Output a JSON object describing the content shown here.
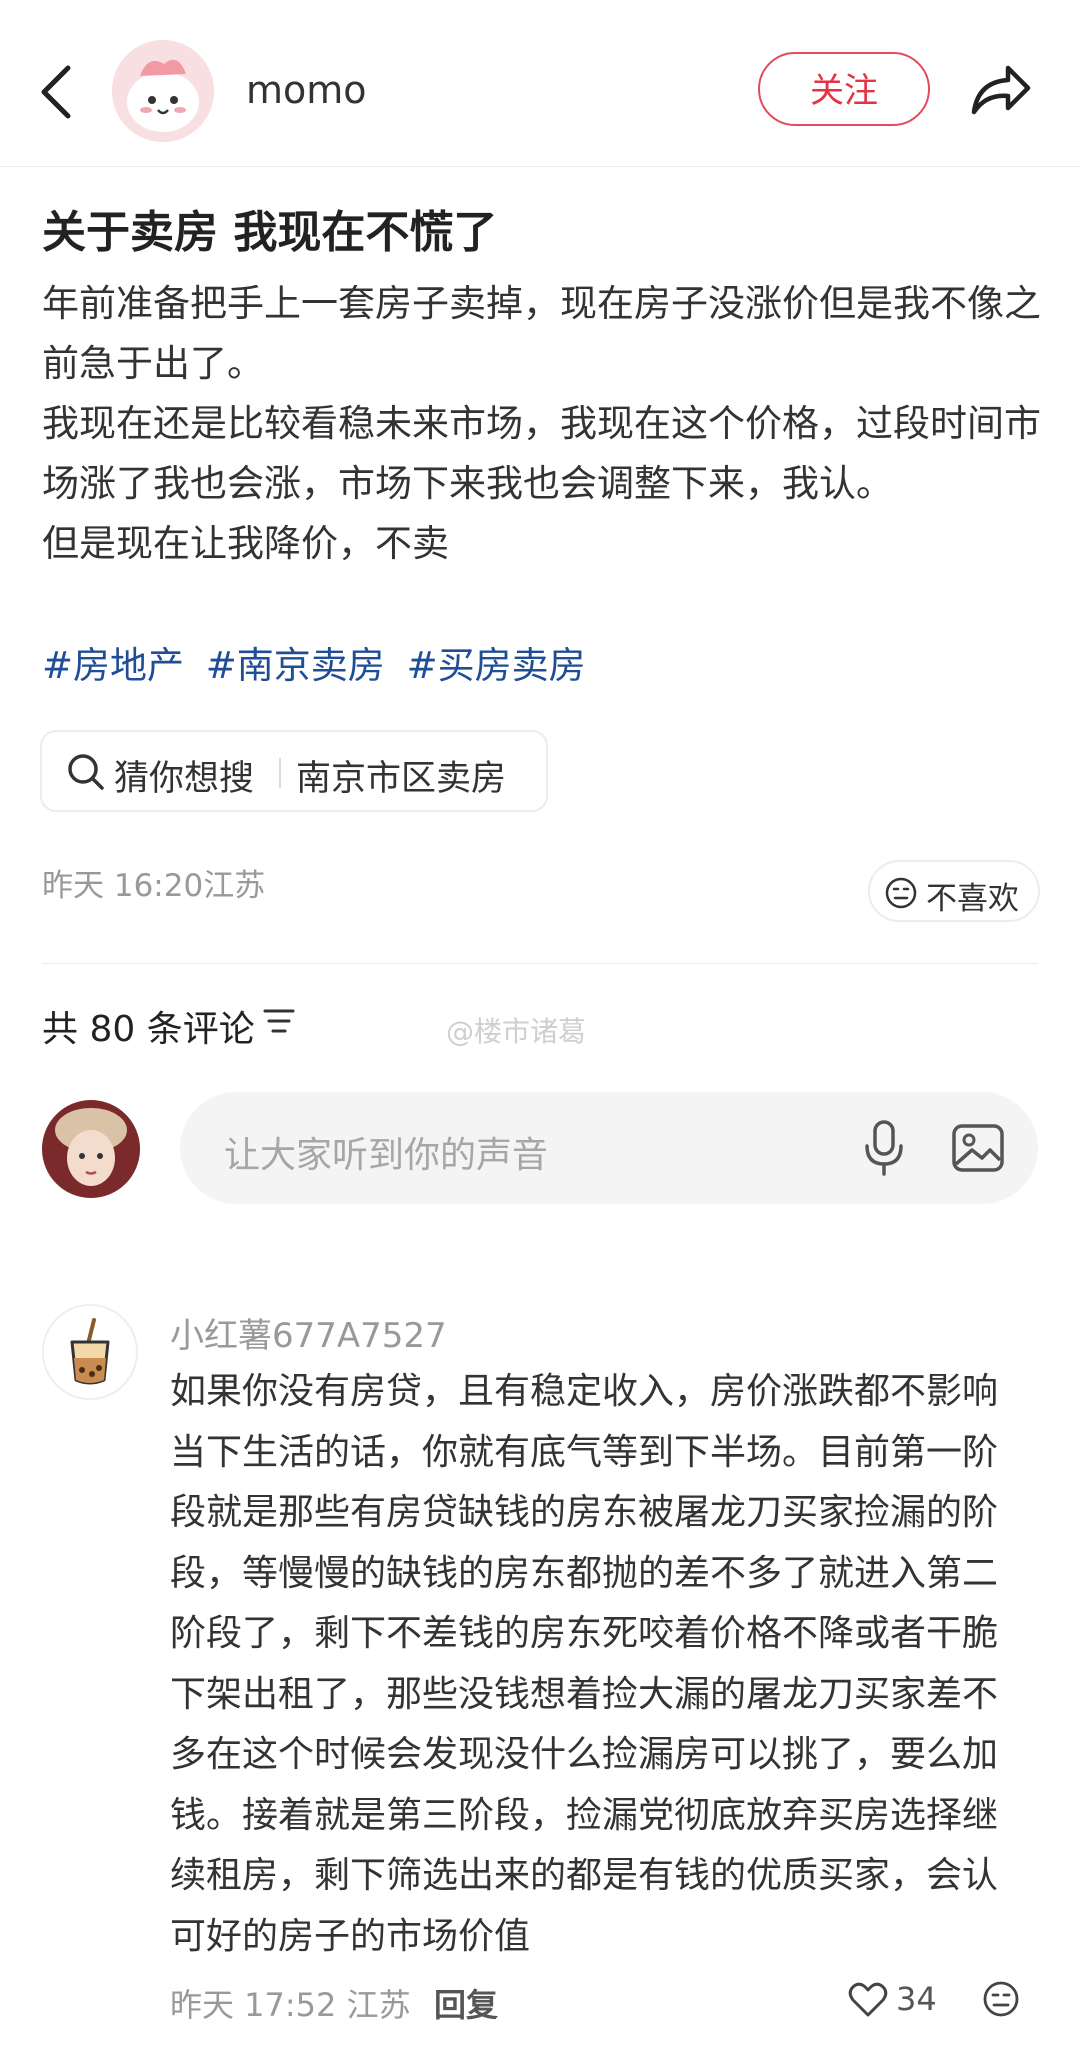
{
  "header": {
    "username": "momo",
    "follow_label": "关注"
  },
  "post": {
    "title": "关于卖房 我现在不慌了",
    "paragraphs": [
      "年前准备把手上一套房子卖掉，现在房子没涨价但是我不像之前急于出了。",
      "我现在还是比较看稳未来市场，我现在这个价格，过段时间市场涨了我也会涨，市场下来我也会调整下来，我认。",
      "但是现在让我降价，不卖"
    ],
    "tags": [
      "#房地产",
      "#南京卖房",
      "#买房卖房"
    ],
    "search_prefix": "猜你想搜",
    "search_term": "南京市区卖房",
    "meta": "昨天 16:20江苏",
    "dislike_label": "不喜欢"
  },
  "comments_section": {
    "count_label": "共 80 条评论",
    "watermark": "@楼市诸葛",
    "input_placeholder": "让大家听到你的声音"
  },
  "comment": {
    "author": "小红薯677A7527",
    "text": "如果你没有房贷，且有稳定收入，房价涨跌都不影响当下生活的话，你就有底气等到下半场。目前第一阶段就是那些有房贷缺钱的房东被屠龙刀买家捡漏的阶段，等慢慢的缺钱的房东都抛的差不多了就进入第二阶段了，剩下不差钱的房东死咬着价格不降或者干脆下架出租了，那些没钱想着捡大漏的屠龙刀买家差不多在这个时候会发现没什么捡漏房可以挑了，要么加钱。接着就是第三阶段，捡漏党彻底放弃买房选择继续租房，剩下筛选出来的都是有钱的优质买家，会认可好的房子的市场价值",
    "meta": "昨天 17:52 江苏",
    "reply_label": "回复",
    "likes": "34"
  },
  "colors": {
    "accent": "#e33344",
    "tag": "#1f4e96",
    "muted": "#999999"
  }
}
